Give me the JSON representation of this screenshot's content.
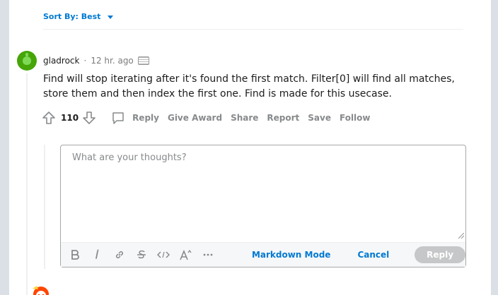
{
  "sort": {
    "label": "Sort By: Best"
  },
  "comment": {
    "username": "gladrock",
    "separator": "·",
    "time": "12 hr. ago",
    "body": "Find will stop iterating after it's found the first match. Filter[0] will find all matches, store them and then index the first one. Find is made for this usecase.",
    "score": "110",
    "actions": {
      "reply": "Reply",
      "give_award": "Give Award",
      "share": "Share",
      "report": "Report",
      "save": "Save",
      "follow": "Follow"
    }
  },
  "editor": {
    "placeholder": "What are your thoughts?",
    "markdown_mode": "Markdown Mode",
    "cancel": "Cancel",
    "reply": "Reply",
    "tools": [
      "bold-icon",
      "italic-icon",
      "link-icon",
      "strikethrough-icon",
      "inline-code-icon",
      "superscript-icon",
      "more-icon"
    ]
  },
  "colors": {
    "accent": "#0079d3",
    "background": "#dae0e6",
    "muted": "#878a8c",
    "avatar": "#46a508"
  }
}
